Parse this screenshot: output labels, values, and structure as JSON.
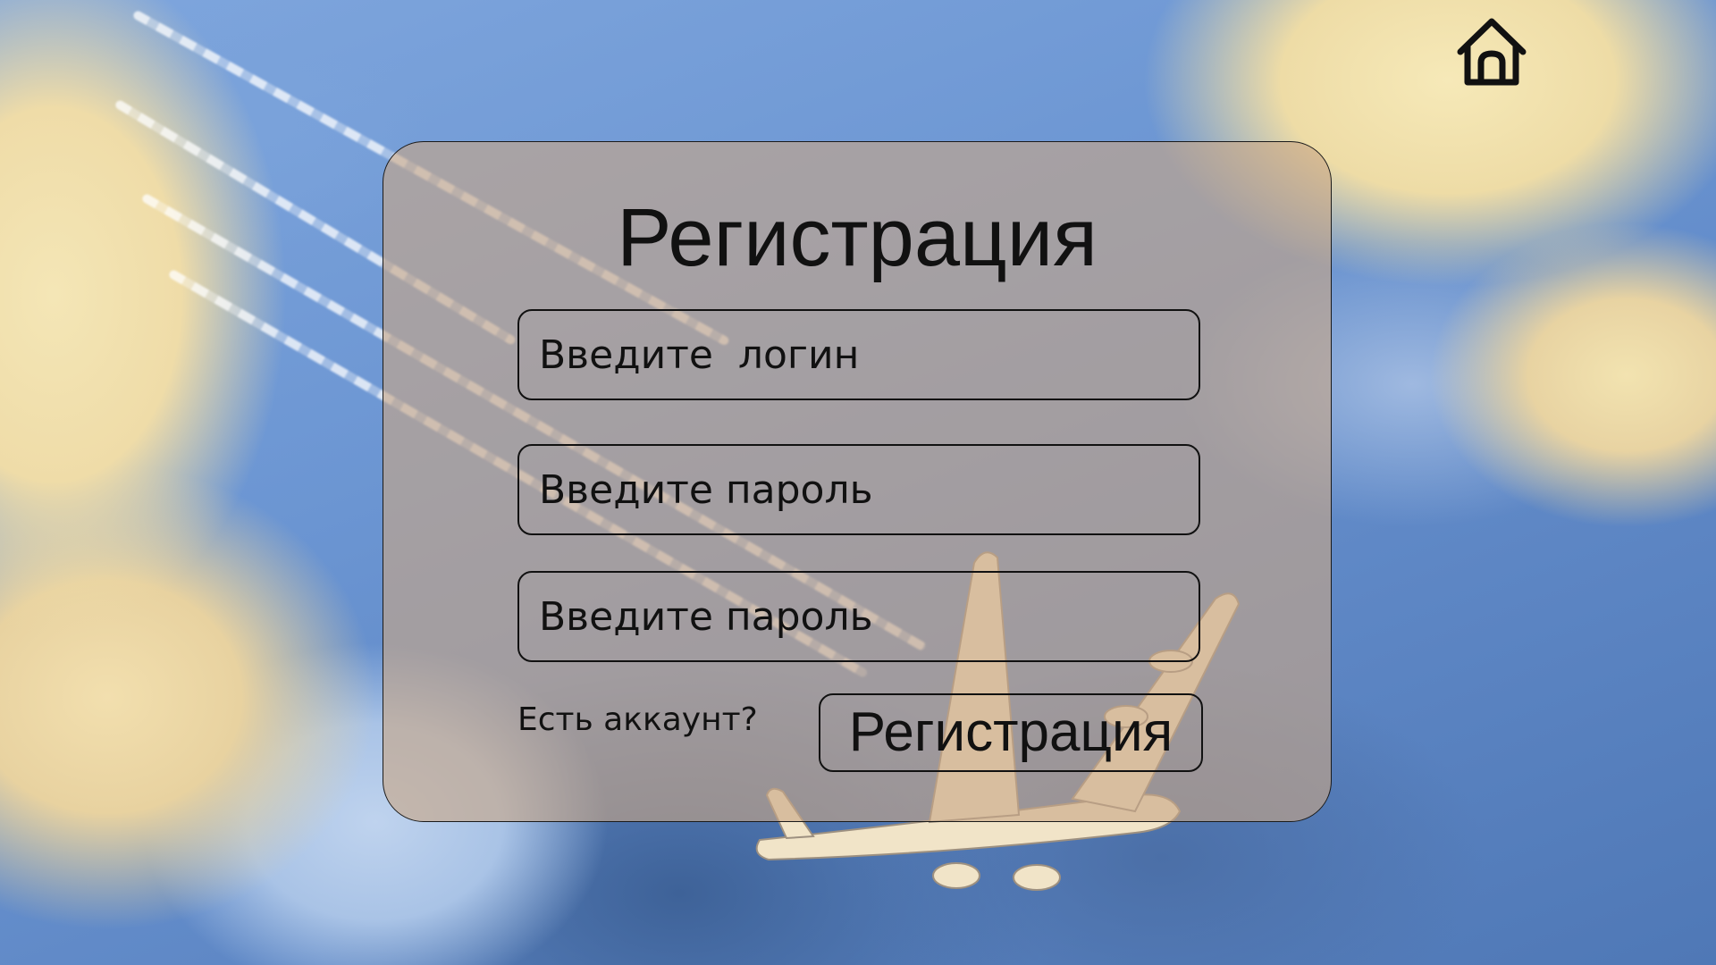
{
  "page": {
    "title": "Регистрация"
  },
  "header": {
    "home_icon": "home-icon"
  },
  "form": {
    "login_placeholder": "Введите  логин",
    "login_value": "",
    "password_placeholder": "Введите пароль",
    "password_value": "",
    "password_confirm_placeholder": "Введите пароль",
    "password_confirm_value": "",
    "have_account_link": "Есть аккаунт?",
    "submit_label": "Регистрация"
  },
  "colors": {
    "card_fill": "#c8a686",
    "border": "#111111",
    "sky": "#6f9ad6",
    "cloud": "#f4e6b6"
  }
}
